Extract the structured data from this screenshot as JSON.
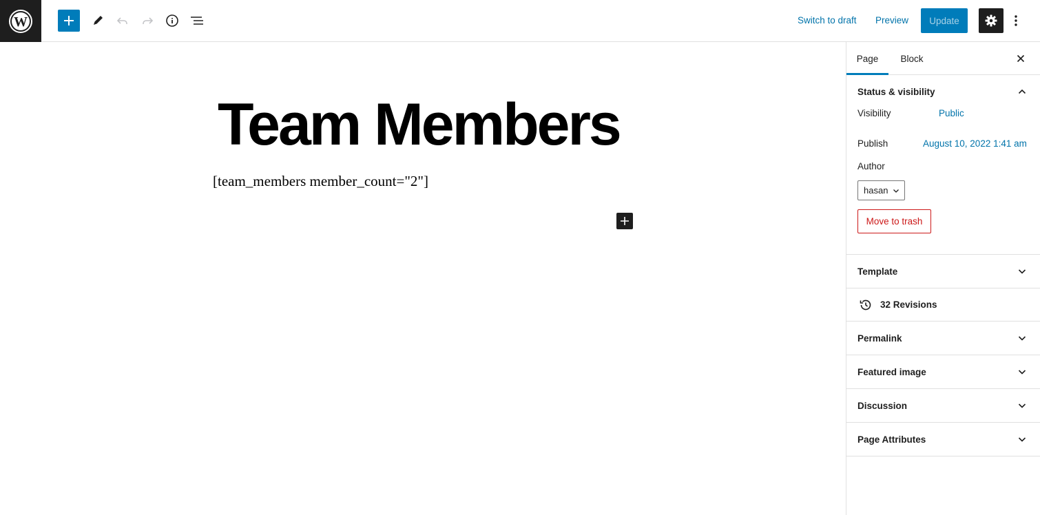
{
  "toolbar": {
    "switch_to_draft": "Switch to draft",
    "preview": "Preview",
    "update": "Update"
  },
  "editor": {
    "title": "Team Members",
    "shortcode": "[team_members member_count=\"2\"]"
  },
  "sidebar": {
    "tabs": [
      {
        "label": "Page",
        "active": true
      },
      {
        "label": "Block",
        "active": false
      }
    ],
    "status_panel": {
      "title": "Status & visibility",
      "visibility_label": "Visibility",
      "visibility_value": "Public",
      "publish_label": "Publish",
      "publish_value": "August 10, 2022 1:41 am",
      "author_label": "Author",
      "author_value": "hasan",
      "trash_label": "Move to trash"
    },
    "panels": {
      "template": "Template",
      "revisions": "32 Revisions",
      "permalink": "Permalink",
      "featured_image": "Featured image",
      "discussion": "Discussion",
      "page_attributes": "Page Attributes"
    }
  },
  "colors": {
    "accent": "#007cba",
    "link": "#0073aa",
    "danger": "#cc1818",
    "dark": "#1e1e1e"
  },
  "icons": [
    "wordpress-logo-icon",
    "plus-icon",
    "pencil-icon",
    "undo-icon",
    "redo-icon",
    "info-icon",
    "list-view-icon",
    "gear-icon",
    "more-vertical-icon",
    "close-icon",
    "chevron-up-icon",
    "chevron-down-icon",
    "history-icon"
  ]
}
